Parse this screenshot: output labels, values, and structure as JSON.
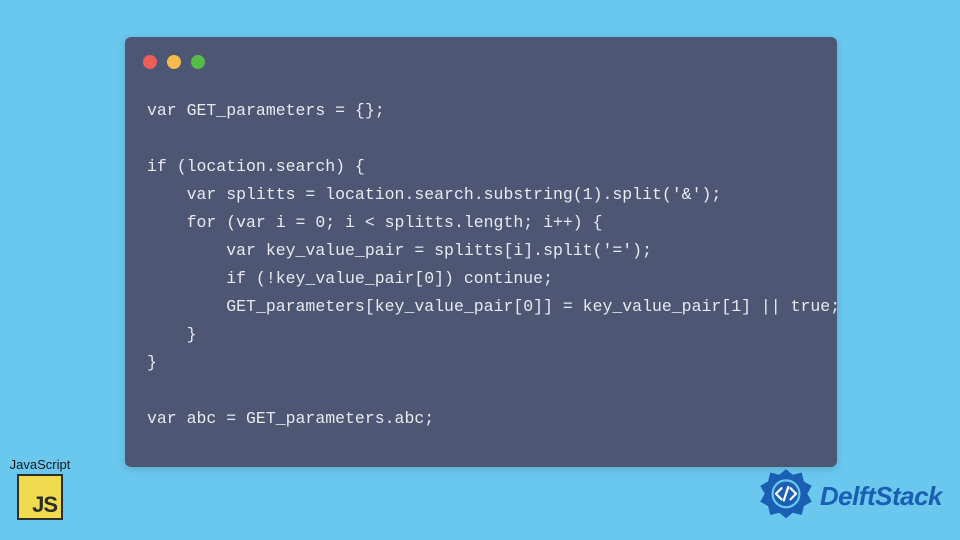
{
  "badge": {
    "label": "JavaScript",
    "logo_text": "JS"
  },
  "brand": {
    "name": "DelftStack"
  },
  "code": {
    "lines": [
      "var GET_parameters = {};",
      "",
      "if (location.search) {",
      "    var splitts = location.search.substring(1).split('&');",
      "    for (var i = 0; i < splitts.length; i++) {",
      "        var key_value_pair = splitts[i].split('=');",
      "        if (!key_value_pair[0]) continue;",
      "        GET_parameters[key_value_pair[0]] = key_value_pair[1] || true;",
      "    }",
      "}",
      "",
      "var abc = GET_parameters.abc;"
    ]
  },
  "window": {
    "traffic_lights": [
      "red",
      "yellow",
      "green"
    ]
  }
}
